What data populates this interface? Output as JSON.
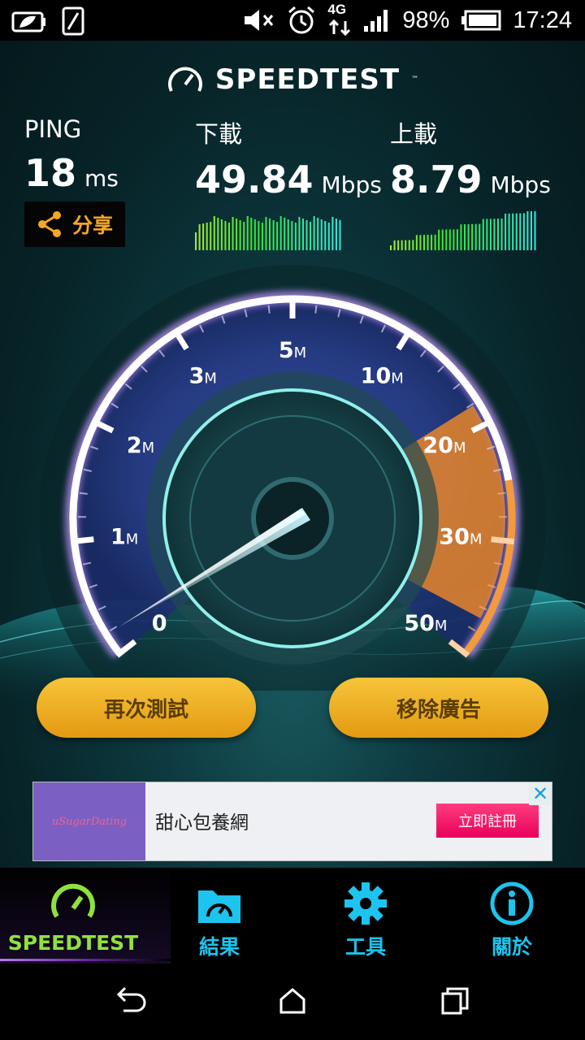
{
  "status_bar": {
    "battery_pct": "98%",
    "time": "17:24",
    "network": "4G"
  },
  "app": {
    "logo": "SPEEDTEST",
    "tm": "™"
  },
  "ping": {
    "label": "PING",
    "value": "18",
    "unit": "ms"
  },
  "download": {
    "label": "下載",
    "value": "49.84",
    "unit": "Mbps"
  },
  "upload": {
    "label": "上載",
    "value": "8.79",
    "unit": "Mbps"
  },
  "share": {
    "label": "分享"
  },
  "gauge": {
    "ticks": [
      {
        "num": "0",
        "unit": ""
      },
      {
        "num": "1",
        "unit": "M"
      },
      {
        "num": "2",
        "unit": "M"
      },
      {
        "num": "3",
        "unit": "M"
      },
      {
        "num": "5",
        "unit": "M"
      },
      {
        "num": "10",
        "unit": "M"
      },
      {
        "num": "20",
        "unit": "M"
      },
      {
        "num": "30",
        "unit": "M"
      },
      {
        "num": "50",
        "unit": "M"
      }
    ],
    "colors": {
      "ring": "#ffffff",
      "fill": "#e9862a",
      "glow": "#b48cf0"
    }
  },
  "buttons": {
    "retest": "再次測試",
    "remove_ads": "移除廣告"
  },
  "ad": {
    "image_text": "uSugarDating",
    "text": "甜心包養網",
    "cta": "立即註冊",
    "close": "✕"
  },
  "tabs": [
    {
      "label": "SPEEDTEST",
      "icon": "speedometer-icon",
      "active": true
    },
    {
      "label": "結果",
      "icon": "results-folder-icon",
      "active": false
    },
    {
      "label": "工具",
      "icon": "gear-icon",
      "active": false
    },
    {
      "label": "關於",
      "icon": "info-icon",
      "active": false
    }
  ],
  "colors": {
    "accent": "#1dc4ee",
    "active_tab": "#8fe23c",
    "button": "#f0b02a"
  }
}
